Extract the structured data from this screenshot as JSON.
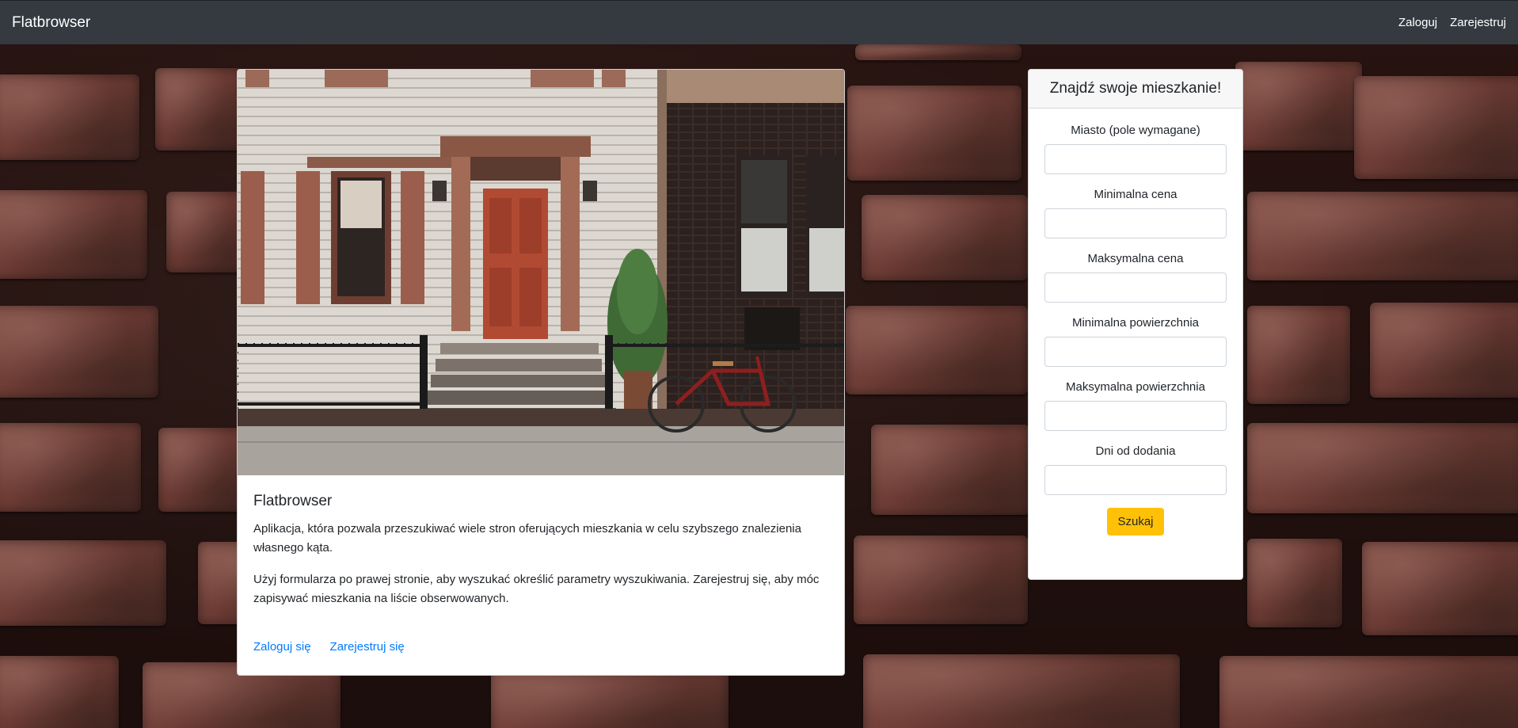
{
  "navbar": {
    "brand": "Flatbrowser",
    "links": [
      "Zaloguj",
      "Zarejestruj"
    ]
  },
  "info_card": {
    "title": "Flatbrowser",
    "paragraphs": [
      "Aplikacja, która pozwala przeszukiwać wiele stron oferujących mieszkania w celu szybszego znalezienia własnego kąta.",
      "Użyj formularza po prawej stronie, aby wyszukać określić parametry wyszukiwania. Zarejestruj się, aby móc zapisywać mieszkania na liście obserwowanych."
    ],
    "links": [
      "Zaloguj się",
      "Zarejestruj się"
    ]
  },
  "search_form": {
    "title": "Znajdź swoje mieszkanie!",
    "fields": [
      {
        "label": "Miasto (pole wymagane)",
        "value": ""
      },
      {
        "label": "Minimalna cena",
        "value": ""
      },
      {
        "label": "Maksymalna cena",
        "value": ""
      },
      {
        "label": "Minimalna powierzchnia",
        "value": ""
      },
      {
        "label": "Maksymalna powierzchnia",
        "value": ""
      },
      {
        "label": "Dni od dodania",
        "value": ""
      }
    ],
    "submit_label": "Szukaj"
  },
  "colors": {
    "navbar": "#343a40",
    "link": "#007bff",
    "button": "#ffc107",
    "brick": "#6a3a33"
  }
}
